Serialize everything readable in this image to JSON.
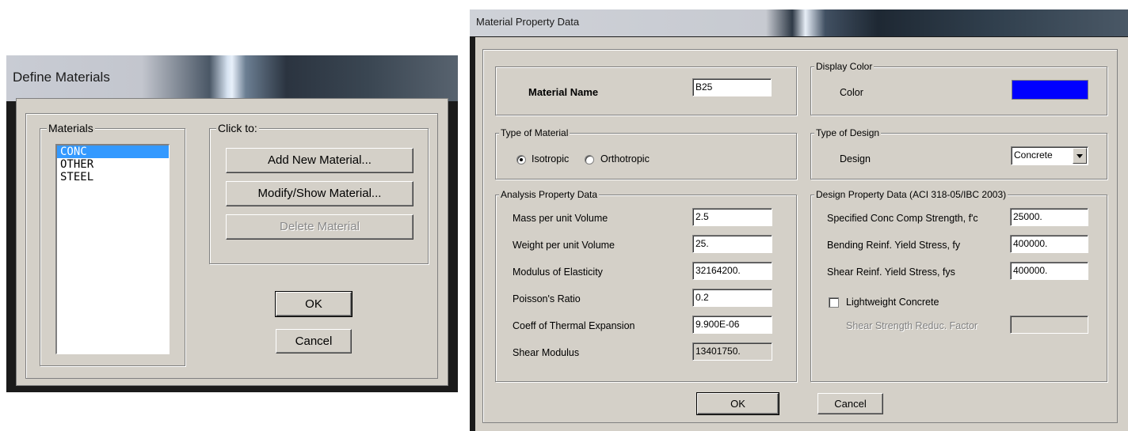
{
  "define_materials": {
    "title": "Define Materials",
    "materials_group": "Materials",
    "materials": [
      "CONC",
      "OTHER",
      "STEEL"
    ],
    "selected_material": "CONC",
    "click_group": "Click to:",
    "add_label": "Add New Material...",
    "modify_label": "Modify/Show Material...",
    "delete_label": "Delete Material",
    "ok_label": "OK",
    "cancel_label": "Cancel"
  },
  "material_property": {
    "title": "Material Property Data",
    "name_label": "Material Name",
    "name_value": "B25",
    "display_color_group": "Display Color",
    "color_label": "Color",
    "color_value": "#0000ff",
    "type_group": "Type of Material",
    "isotropic_label": "Isotropic",
    "orthotropic_label": "Orthotropic",
    "selected_type": "Isotropic",
    "design_type_group": "Type of Design",
    "design_label": "Design",
    "design_value": "Concrete",
    "analysis_group": "Analysis Property Data",
    "analysis": [
      {
        "label": "Mass per unit Volume",
        "value": "2.5"
      },
      {
        "label": "Weight per unit Volume",
        "value": "25."
      },
      {
        "label": "Modulus of Elasticity",
        "value": "32164200."
      },
      {
        "label": "Poisson's Ratio",
        "value": "0.2"
      },
      {
        "label": "Coeff of Thermal Expansion",
        "value": "9.900E-06"
      },
      {
        "label": "Shear Modulus",
        "value": "13401750."
      }
    ],
    "design_group": "Design Property Data (ACI 318-05/IBC 2003)",
    "design_props": [
      {
        "label": "Specified Conc Comp Strength, f'c",
        "value": "25000."
      },
      {
        "label": "Bending Reinf. Yield Stress, fy",
        "value": "400000."
      },
      {
        "label": "Shear Reinf. Yield Stress, fys",
        "value": "400000."
      }
    ],
    "lightweight_label": "Lightweight Concrete",
    "lightweight_checked": false,
    "shear_reduc_label": "Shear Strength Reduc. Factor",
    "shear_reduc_value": "",
    "ok_label": "OK",
    "cancel_label": "Cancel"
  }
}
